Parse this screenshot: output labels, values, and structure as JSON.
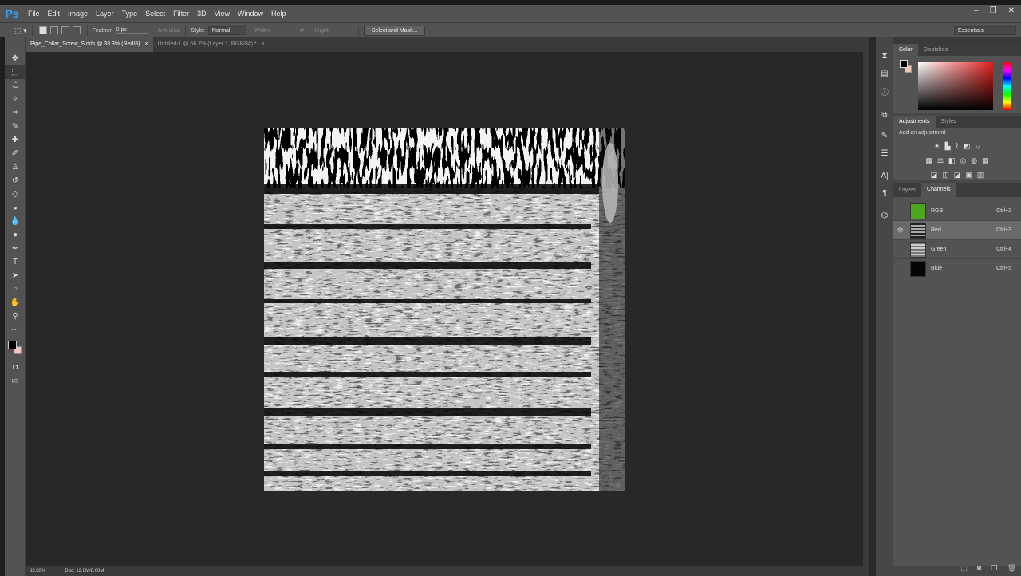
{
  "app": {
    "logo": "Ps"
  },
  "menu": [
    "File",
    "Edit",
    "Image",
    "Layer",
    "Type",
    "Select",
    "Filter",
    "3D",
    "View",
    "Window",
    "Help"
  ],
  "window_controls": [
    "–",
    "❐",
    "✕"
  ],
  "options": {
    "feather_label": "Feather:",
    "feather_value": "0 px",
    "antialias_label": "Anti-alias",
    "style_label": "Style:",
    "style_value": "Normal",
    "width_label": "Width:",
    "height_label": "Height:",
    "select_mask_label": "Select and Mask...",
    "workspace_value": "Essentials"
  },
  "tabs": [
    {
      "label": "Pipe_Collar_Screw_S.dds @ 33.3% (Red/8)",
      "close": "×"
    },
    {
      "label": "Untitled-1 @ 66.7% (Layer 1, RGB/8#) *",
      "close": "×"
    }
  ],
  "status": {
    "zoom": "33.33%",
    "doc": "Doc: 12.0M/8.00M",
    "arrow": "›"
  },
  "color_panel": {
    "tabs": [
      "Color",
      "Swatches"
    ],
    "fg": "#000000",
    "bg": "#f2c7b8",
    "hue": "#e0201e"
  },
  "adjustments_panel": {
    "tabs": [
      "Adjustments",
      "Styles"
    ],
    "title": "Add an adjustment"
  },
  "channels_panel": {
    "tabs": [
      "Layers",
      "Channels"
    ],
    "channels": [
      {
        "name": "RGB",
        "shortcut": "Ctrl+2",
        "visible": false,
        "thumb": "#4ea51e"
      },
      {
        "name": "Red",
        "shortcut": "Ctrl+3",
        "visible": true,
        "thumb": "#777777"
      },
      {
        "name": "Green",
        "shortcut": "Ctrl+4",
        "visible": false,
        "thumb": "#999999"
      },
      {
        "name": "Blue",
        "shortcut": "Ctrl+5",
        "visible": false,
        "thumb": "#050505"
      }
    ]
  },
  "icons": {
    "tools": [
      "move-icon",
      "marquee-icon",
      "lasso-icon",
      "magic-wand-icon",
      "crop-icon",
      "eyedropper-icon",
      "healing-brush-icon",
      "brush-icon",
      "clone-stamp-icon",
      "history-brush-icon",
      "eraser-icon",
      "paint-bucket-icon",
      "blur-icon",
      "dodge-icon",
      "pen-icon",
      "type-icon",
      "path-select-icon",
      "ellipse-icon",
      "hand-icon",
      "zoom-icon",
      "more-tools-icon"
    ],
    "panel_side": [
      "history-icon",
      "libraries-icon",
      "info-icon",
      "clone-source-icon",
      "brushes-icon",
      "properties-icon",
      "character-icon",
      "paragraph-icon",
      "paths-icon"
    ]
  }
}
